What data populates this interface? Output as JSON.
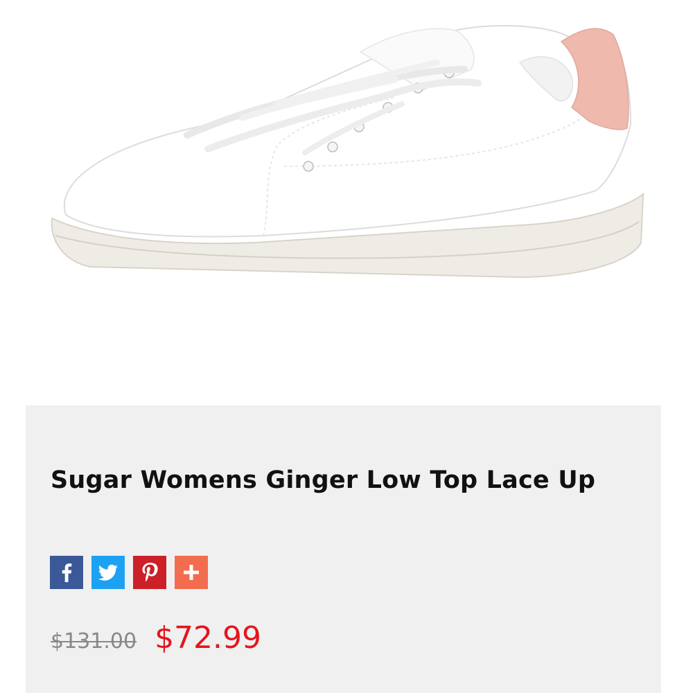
{
  "product": {
    "title": "Sugar Womens Ginger Low Top Lace Up",
    "image_icon": "white-sneaker-image"
  },
  "share": {
    "items": [
      {
        "name": "facebook",
        "icon": "facebook-icon",
        "color": "#3b5998"
      },
      {
        "name": "twitter",
        "icon": "twitter-icon",
        "color": "#1da1f2"
      },
      {
        "name": "pinterest",
        "icon": "pinterest-icon",
        "color": "#cb2027"
      },
      {
        "name": "more",
        "icon": "plus-icon",
        "color": "#f36c4f"
      }
    ]
  },
  "pricing": {
    "original_price": "$131.00",
    "sale_price": "$72.99",
    "sale_color": "#e3161b"
  },
  "colors": {
    "panel_background": "#f0f0f0",
    "title_text": "#111111"
  }
}
